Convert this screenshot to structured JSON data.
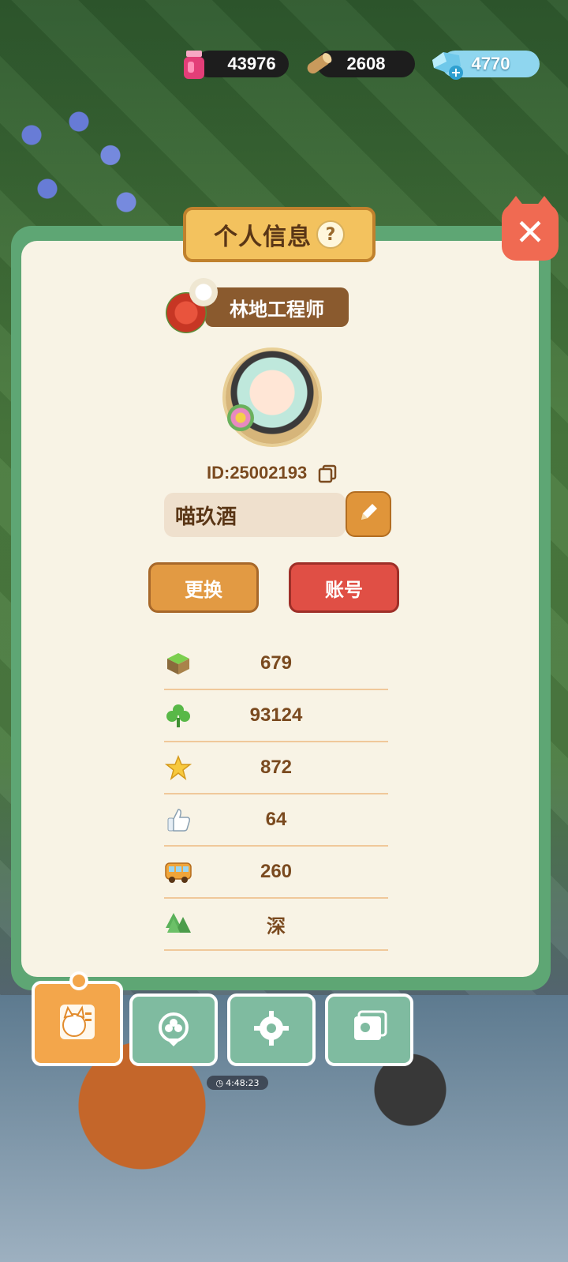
{
  "currencies": [
    {
      "name": "potion",
      "value": "43976",
      "color": "#e33e78"
    },
    {
      "name": "wood",
      "value": "2608",
      "color": "#c99a5c"
    },
    {
      "name": "diamond",
      "value": "4770",
      "color": "#8fd6ef"
    }
  ],
  "timer": "4:48:23",
  "panel": {
    "title": "个人信息",
    "help": "?",
    "rank_title": "林地工程师",
    "player_id": "ID:25002193",
    "player_name": "喵玖酒",
    "buttons": {
      "change": "更换",
      "account": "账号"
    },
    "stats": [
      {
        "icon": "grass-block-icon",
        "value": "679"
      },
      {
        "icon": "clover-icon",
        "value": "93124"
      },
      {
        "icon": "star-icon",
        "value": "872"
      },
      {
        "icon": "thumbs-up-icon",
        "value": "64"
      },
      {
        "icon": "bus-icon",
        "value": "260"
      },
      {
        "icon": "trees-icon",
        "value": "深"
      }
    ]
  },
  "tabs": [
    {
      "name": "profile-card",
      "active": true
    },
    {
      "name": "badge",
      "active": false
    },
    {
      "name": "gear",
      "active": false
    },
    {
      "name": "photo-album",
      "active": false
    }
  ],
  "colors": {
    "panel_green": "#5ea674",
    "panel_bg": "#f8f3e5",
    "title_plate": "#f3c25e",
    "text_brown": "#7a4a1f",
    "btn_orange": "#e29a43",
    "btn_red": "#e04f45",
    "close_red": "#f06a52"
  }
}
